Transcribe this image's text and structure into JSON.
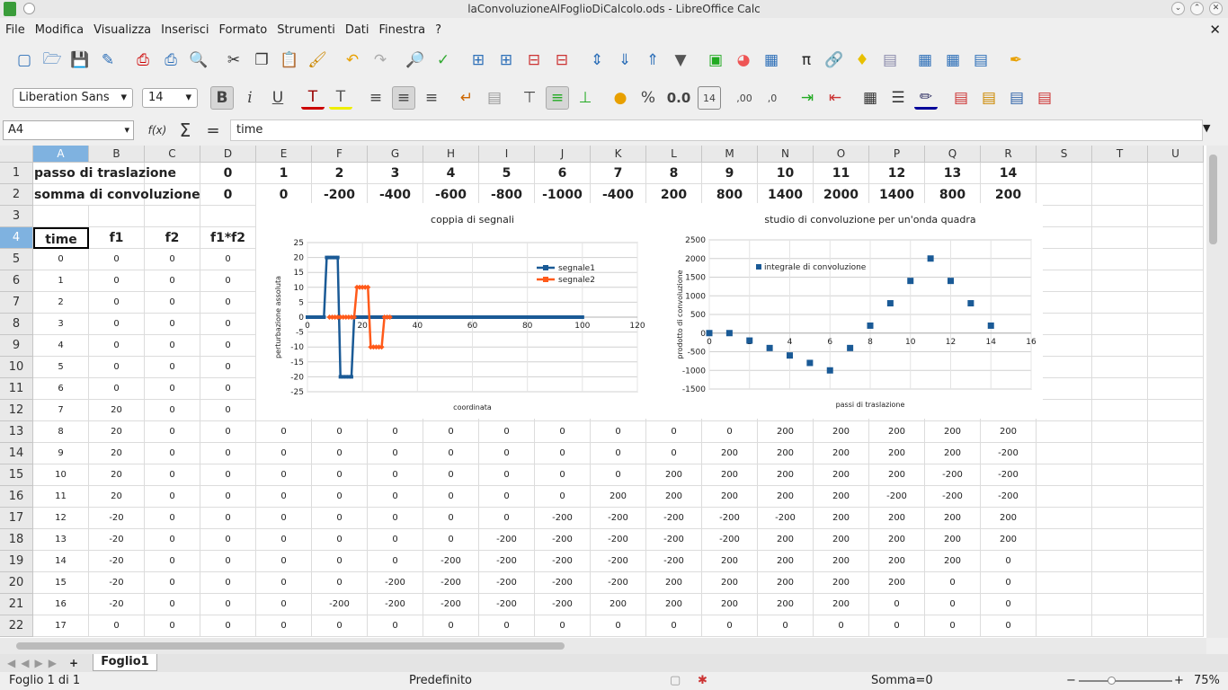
{
  "window": {
    "title": "laConvoluzioneAlFoglioDiCalcolo.ods - LibreOffice Calc"
  },
  "menu": [
    "File",
    "Modifica",
    "Visualizza",
    "Inserisci",
    "Formato",
    "Strumenti",
    "Dati",
    "Finestra",
    "?"
  ],
  "format_bar": {
    "font_name": "Liberation Sans",
    "font_size": "14",
    "number_format": "0.0"
  },
  "formula_bar": {
    "cell_ref": "A4",
    "content": "time"
  },
  "columns": [
    "A",
    "B",
    "C",
    "D",
    "E",
    "F",
    "G",
    "H",
    "I",
    "J",
    "K",
    "L",
    "M",
    "N",
    "O",
    "P",
    "Q",
    "R",
    "S",
    "T",
    "U"
  ],
  "rows": [
    "1",
    "2",
    "3",
    "4",
    "5",
    "6",
    "7",
    "8",
    "9",
    "10",
    "11",
    "12",
    "13",
    "14",
    "15",
    "16",
    "17",
    "18",
    "19",
    "20",
    "21",
    "22"
  ],
  "row1": {
    "label": "passo di traslazione",
    "values": [
      "0",
      "1",
      "2",
      "3",
      "4",
      "5",
      "6",
      "7",
      "8",
      "9",
      "10",
      "11",
      "12",
      "13",
      "14"
    ]
  },
  "row2": {
    "label": "somma di convoluzione",
    "values": [
      "0",
      "0",
      "-200",
      "-400",
      "-600",
      "-800",
      "-1000",
      "-400",
      "200",
      "800",
      "1400",
      "2000",
      "1400",
      "800",
      "200"
    ]
  },
  "headers": [
    "time",
    "f1",
    "f2",
    "f1*f2"
  ],
  "data_rows": [
    [
      "0",
      "0",
      "0",
      "0"
    ],
    [
      "1",
      "0",
      "0",
      "0"
    ],
    [
      "2",
      "0",
      "0",
      "0"
    ],
    [
      "3",
      "0",
      "0",
      "0"
    ],
    [
      "4",
      "0",
      "0",
      "0"
    ],
    [
      "5",
      "0",
      "0",
      "0"
    ],
    [
      "6",
      "0",
      "0",
      "0"
    ],
    [
      "7",
      "20",
      "0",
      "0"
    ],
    [
      "8",
      "20",
      "0",
      "0",
      "0",
      "0",
      "0",
      "0",
      "0",
      "0",
      "0",
      "0",
      "0",
      "200",
      "200",
      "200",
      "200",
      "200"
    ],
    [
      "9",
      "20",
      "0",
      "0",
      "0",
      "0",
      "0",
      "0",
      "0",
      "0",
      "0",
      "0",
      "200",
      "200",
      "200",
      "200",
      "200",
      "-200"
    ],
    [
      "10",
      "20",
      "0",
      "0",
      "0",
      "0",
      "0",
      "0",
      "0",
      "0",
      "0",
      "200",
      "200",
      "200",
      "200",
      "200",
      "-200",
      "-200"
    ],
    [
      "11",
      "20",
      "0",
      "0",
      "0",
      "0",
      "0",
      "0",
      "0",
      "0",
      "200",
      "200",
      "200",
      "200",
      "200",
      "-200",
      "-200",
      "-200"
    ],
    [
      "12",
      "-20",
      "0",
      "0",
      "0",
      "0",
      "0",
      "0",
      "0",
      "-200",
      "-200",
      "-200",
      "-200",
      "-200",
      "200",
      "200",
      "200",
      "200"
    ],
    [
      "13",
      "-20",
      "0",
      "0",
      "0",
      "0",
      "0",
      "0",
      "-200",
      "-200",
      "-200",
      "-200",
      "-200",
      "200",
      "200",
      "200",
      "200",
      "200"
    ],
    [
      "14",
      "-20",
      "0",
      "0",
      "0",
      "0",
      "0",
      "-200",
      "-200",
      "-200",
      "-200",
      "-200",
      "200",
      "200",
      "200",
      "200",
      "200",
      "0"
    ],
    [
      "15",
      "-20",
      "0",
      "0",
      "0",
      "0",
      "-200",
      "-200",
      "-200",
      "-200",
      "-200",
      "200",
      "200",
      "200",
      "200",
      "200",
      "0",
      "0"
    ],
    [
      "16",
      "-20",
      "0",
      "0",
      "0",
      "-200",
      "-200",
      "-200",
      "-200",
      "-200",
      "200",
      "200",
      "200",
      "200",
      "200",
      "0",
      "0",
      "0"
    ],
    [
      "17",
      "0",
      "0",
      "0",
      "0",
      "0",
      "0",
      "0",
      "0",
      "0",
      "0",
      "0",
      "0",
      "0",
      "0",
      "0",
      "0",
      "0"
    ]
  ],
  "chart_data": [
    {
      "type": "line",
      "title": "coppia di segnali",
      "xlabel": "coordinata",
      "ylabel": "perturbazione assoluta",
      "xlim": [
        0,
        120
      ],
      "ylim": [
        -25,
        25
      ],
      "xticks": [
        "0",
        "20",
        "40",
        "60",
        "80",
        "100",
        "120"
      ],
      "yticks": [
        "25",
        "20",
        "15",
        "10",
        "5",
        "0",
        "-5",
        "-10",
        "-15",
        "-20",
        "-25"
      ],
      "legend": "top-right",
      "series": [
        {
          "name": "segnale1",
          "color": "#1a5a96",
          "points": [
            [
              0,
              0
            ],
            [
              6,
              0
            ],
            [
              7,
              20
            ],
            [
              11,
              20
            ],
            [
              12,
              -20
            ],
            [
              16,
              -20
            ],
            [
              17,
              0
            ],
            [
              100,
              0
            ]
          ]
        },
        {
          "name": "segnale2",
          "color": "#ff5a1a",
          "points": [
            [
              8,
              0
            ],
            [
              17,
              0
            ],
            [
              18,
              10
            ],
            [
              22,
              10
            ],
            [
              23,
              -10
            ],
            [
              27,
              -10
            ],
            [
              28,
              0
            ],
            [
              30,
              0
            ]
          ]
        }
      ]
    },
    {
      "type": "scatter",
      "title": "studio di convoluzione per un'onda quadra",
      "xlabel": "passi di traslazione",
      "ylabel": "prodotto di convoluzione",
      "xlim": [
        0,
        16
      ],
      "ylim": [
        -1500,
        2500
      ],
      "xticks": [
        "0",
        "2",
        "4",
        "6",
        "8",
        "10",
        "12",
        "14",
        "16"
      ],
      "yticks": [
        "2500",
        "2000",
        "1500",
        "1000",
        "500",
        "0",
        "-500",
        "-1000",
        "-1500"
      ],
      "legend": "top-left",
      "series": [
        {
          "name": "integrale di convoluzione",
          "color": "#1a5a96",
          "x": [
            0,
            1,
            2,
            3,
            4,
            5,
            6,
            7,
            8,
            9,
            10,
            11,
            12,
            13,
            14
          ],
          "y": [
            0,
            0,
            -200,
            -400,
            -600,
            -800,
            -1000,
            -400,
            200,
            800,
            1400,
            2000,
            1400,
            800,
            200
          ]
        }
      ]
    }
  ],
  "sheet_tab": "Foglio1",
  "status": {
    "sheet": "Foglio 1 di 1",
    "style": "Predefinito",
    "sum": "Somma=0",
    "zoom": "75%"
  }
}
